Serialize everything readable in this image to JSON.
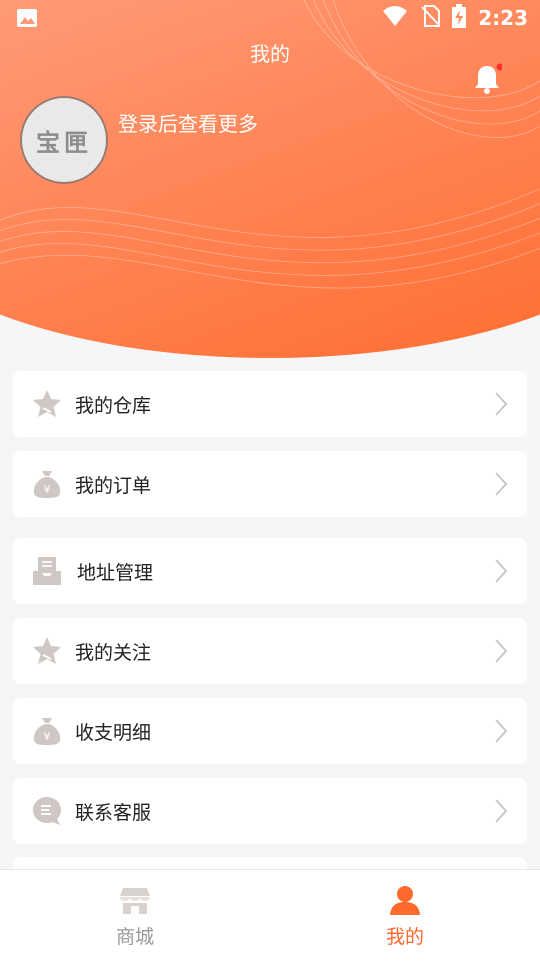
{
  "status": {
    "time": "2:23"
  },
  "header": {
    "title": "我的",
    "login_hint": "登录后查看更多",
    "avatar_text": "宝匣"
  },
  "menu": [
    {
      "label": "我的仓库",
      "icon": "star-icon"
    },
    {
      "label": "我的订单",
      "icon": "money-bag-icon"
    },
    {
      "label": "地址管理",
      "icon": "inbox-icon"
    },
    {
      "label": "我的关注",
      "icon": "star-icon"
    },
    {
      "label": "收支明细",
      "icon": "money-bag-icon"
    },
    {
      "label": "联系客服",
      "icon": "chat-icon"
    }
  ],
  "tabs": [
    {
      "label": "商城",
      "color": "#999999"
    },
    {
      "label": "我的",
      "color": "#ff6a2c"
    }
  ],
  "colors": {
    "accent": "#ff6a2c",
    "icon_gray": "#cfc7c4"
  }
}
